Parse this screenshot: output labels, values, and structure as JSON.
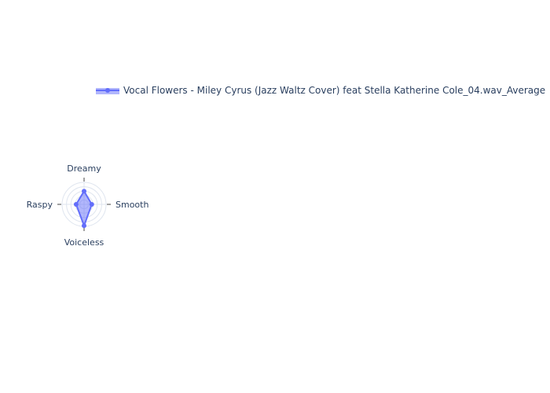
{
  "chart_data": {
    "type": "radar",
    "axes": [
      "Dreamy",
      "Smooth",
      "Voiceless",
      "Raspy"
    ],
    "range": [
      0,
      1
    ],
    "series": [
      {
        "name": "Vocal Flowers - Miley Cyrus (Jazz Waltz Cover) feat Stella Katherine Cole_04.wav_Average",
        "values": [
          0.6,
          0.35,
          0.97,
          0.36
        ]
      }
    ],
    "grid": true,
    "legend_position": "top-right"
  },
  "colors": {
    "series_line": "#636efa",
    "series_fill": "rgba(99,110,250,0.5)",
    "grid": "#dfe5ef",
    "polar_bg": "#e5ecf6",
    "tick": "#444444",
    "text": "#2a3f5f"
  }
}
